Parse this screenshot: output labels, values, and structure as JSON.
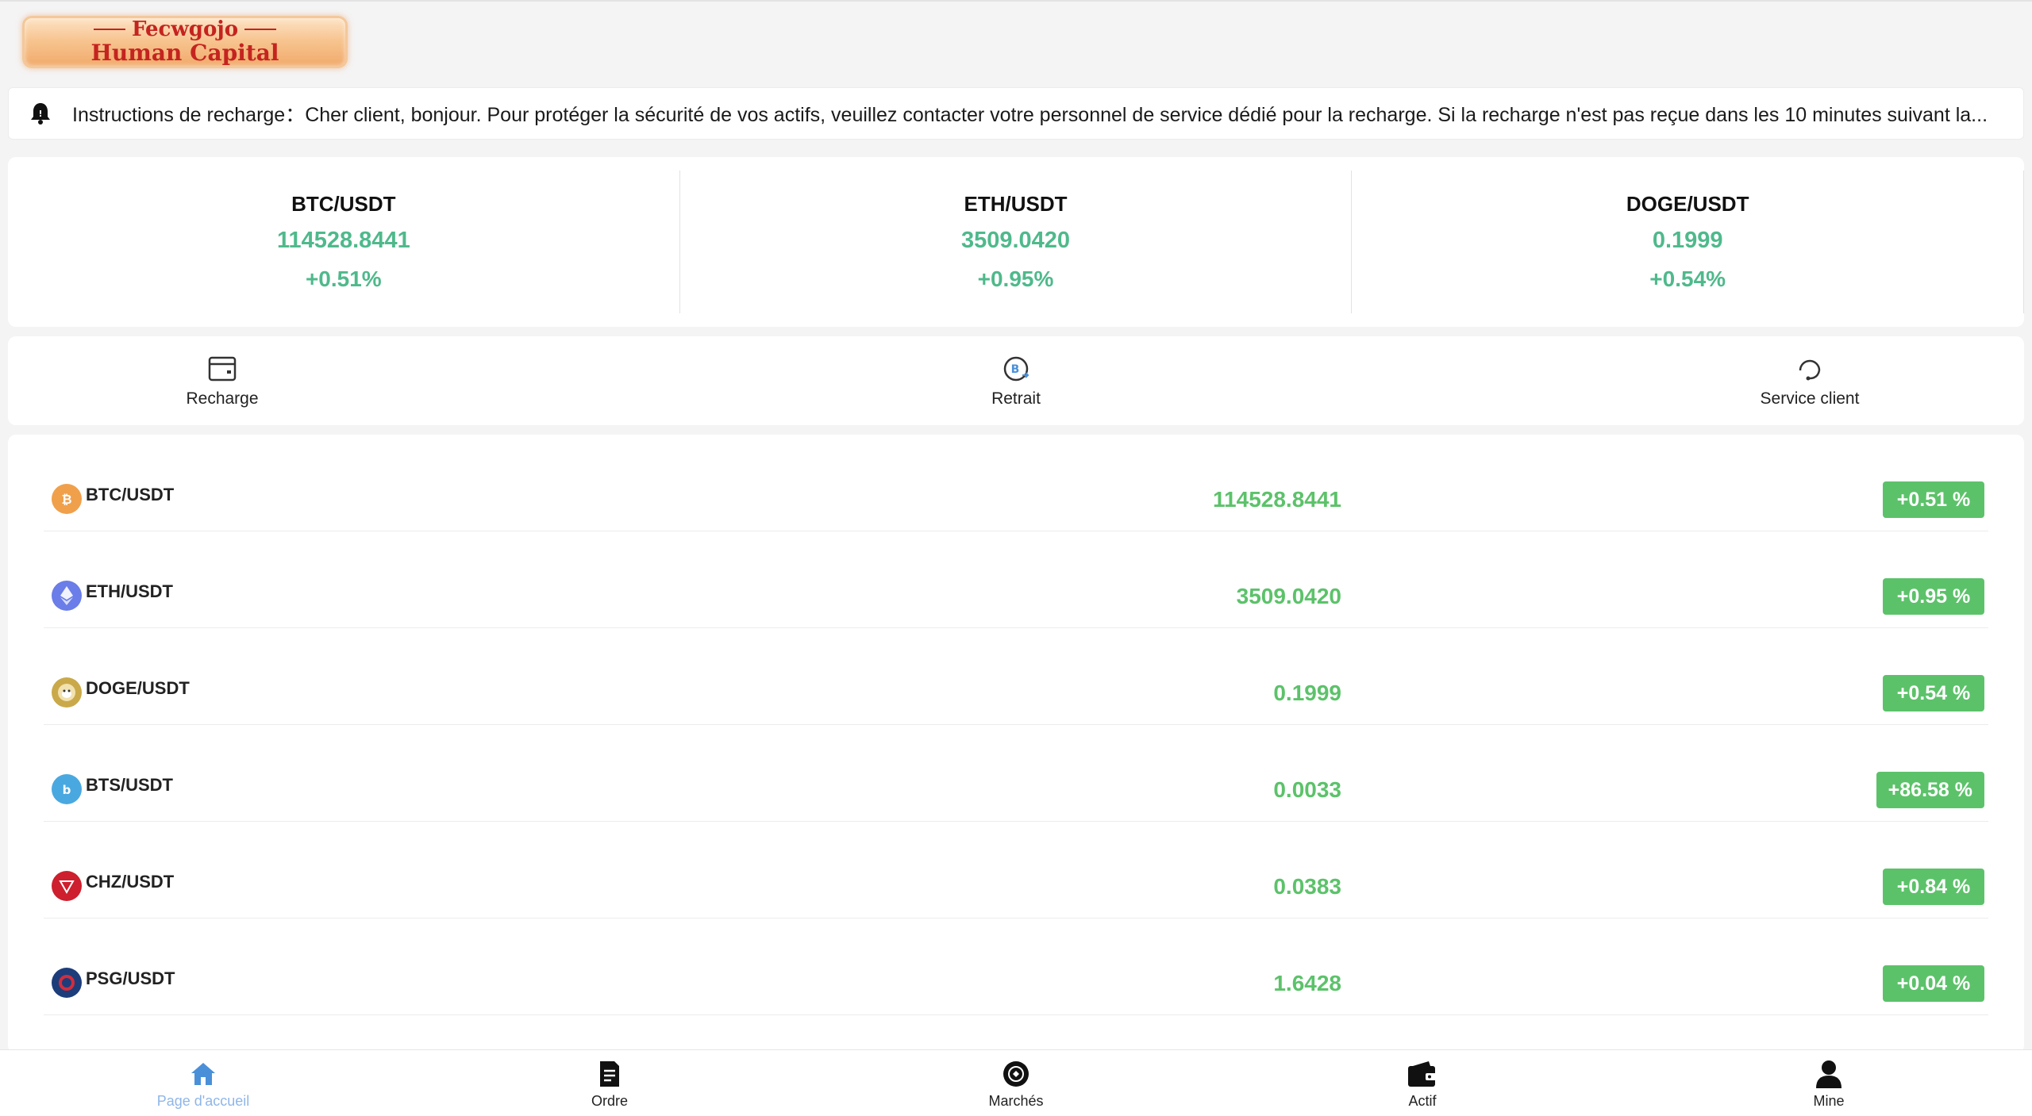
{
  "brand": {
    "line1": "Fecwgojo",
    "line2": "Human Capital"
  },
  "notice": {
    "icon": "bell-icon",
    "text": "Instructions de recharge：Cher client, bonjour. Pour protéger la sécurité de vos actifs, veuillez contacter votre personnel de service dédié pour la recharge. Si la recharge n'est pas reçue dans les 10 minutes suivant la..."
  },
  "tickers": [
    {
      "pair": "BTC/USDT",
      "price": "114528.8441",
      "change": "+0.51%"
    },
    {
      "pair": "ETH/USDT",
      "price": "3509.0420",
      "change": "+0.95%"
    },
    {
      "pair": "DOGE/USDT",
      "price": "0.1999",
      "change": "+0.54%"
    }
  ],
  "actions": [
    {
      "label": "Recharge",
      "icon": "wallet-icon"
    },
    {
      "label": "Retrait",
      "icon": "withdraw-coin-icon"
    },
    {
      "label": "Service client",
      "icon": "headset-icon"
    }
  ],
  "market": [
    {
      "pair": "BTC/USDT",
      "price": "114528.8441",
      "change": "+0.51 %",
      "icon": "btc-icon",
      "color": "#f0a04b"
    },
    {
      "pair": "ETH/USDT",
      "price": "3509.0420",
      "change": "+0.95 %",
      "icon": "eth-icon",
      "color": "#6a7de8"
    },
    {
      "pair": "DOGE/USDT",
      "price": "0.1999",
      "change": "+0.54 %",
      "icon": "doge-icon",
      "color": "#c9a94a"
    },
    {
      "pair": "BTS/USDT",
      "price": "0.0033",
      "change": "+86.58 %",
      "icon": "bts-icon",
      "color": "#4aa8e0"
    },
    {
      "pair": "CHZ/USDT",
      "price": "0.0383",
      "change": "+0.84 %",
      "icon": "chz-icon",
      "color": "#cd1f2d"
    },
    {
      "pair": "PSG/USDT",
      "price": "1.6428",
      "change": "+0.04 %",
      "icon": "psg-icon",
      "color": "#1d3c7a"
    }
  ],
  "nav": [
    {
      "label": "Page d'accueil",
      "icon": "home-icon",
      "active": true
    },
    {
      "label": "Ordre",
      "icon": "document-icon",
      "active": false
    },
    {
      "label": "Marchés",
      "icon": "market-icon",
      "active": false
    },
    {
      "label": "Actif",
      "icon": "wallet-icon",
      "active": false
    },
    {
      "label": "Mine",
      "icon": "user-icon",
      "active": false
    }
  ],
  "colors": {
    "up": "#5cc26a",
    "ticker_up": "#4fb98c",
    "nav_active": "#4a90d9"
  }
}
